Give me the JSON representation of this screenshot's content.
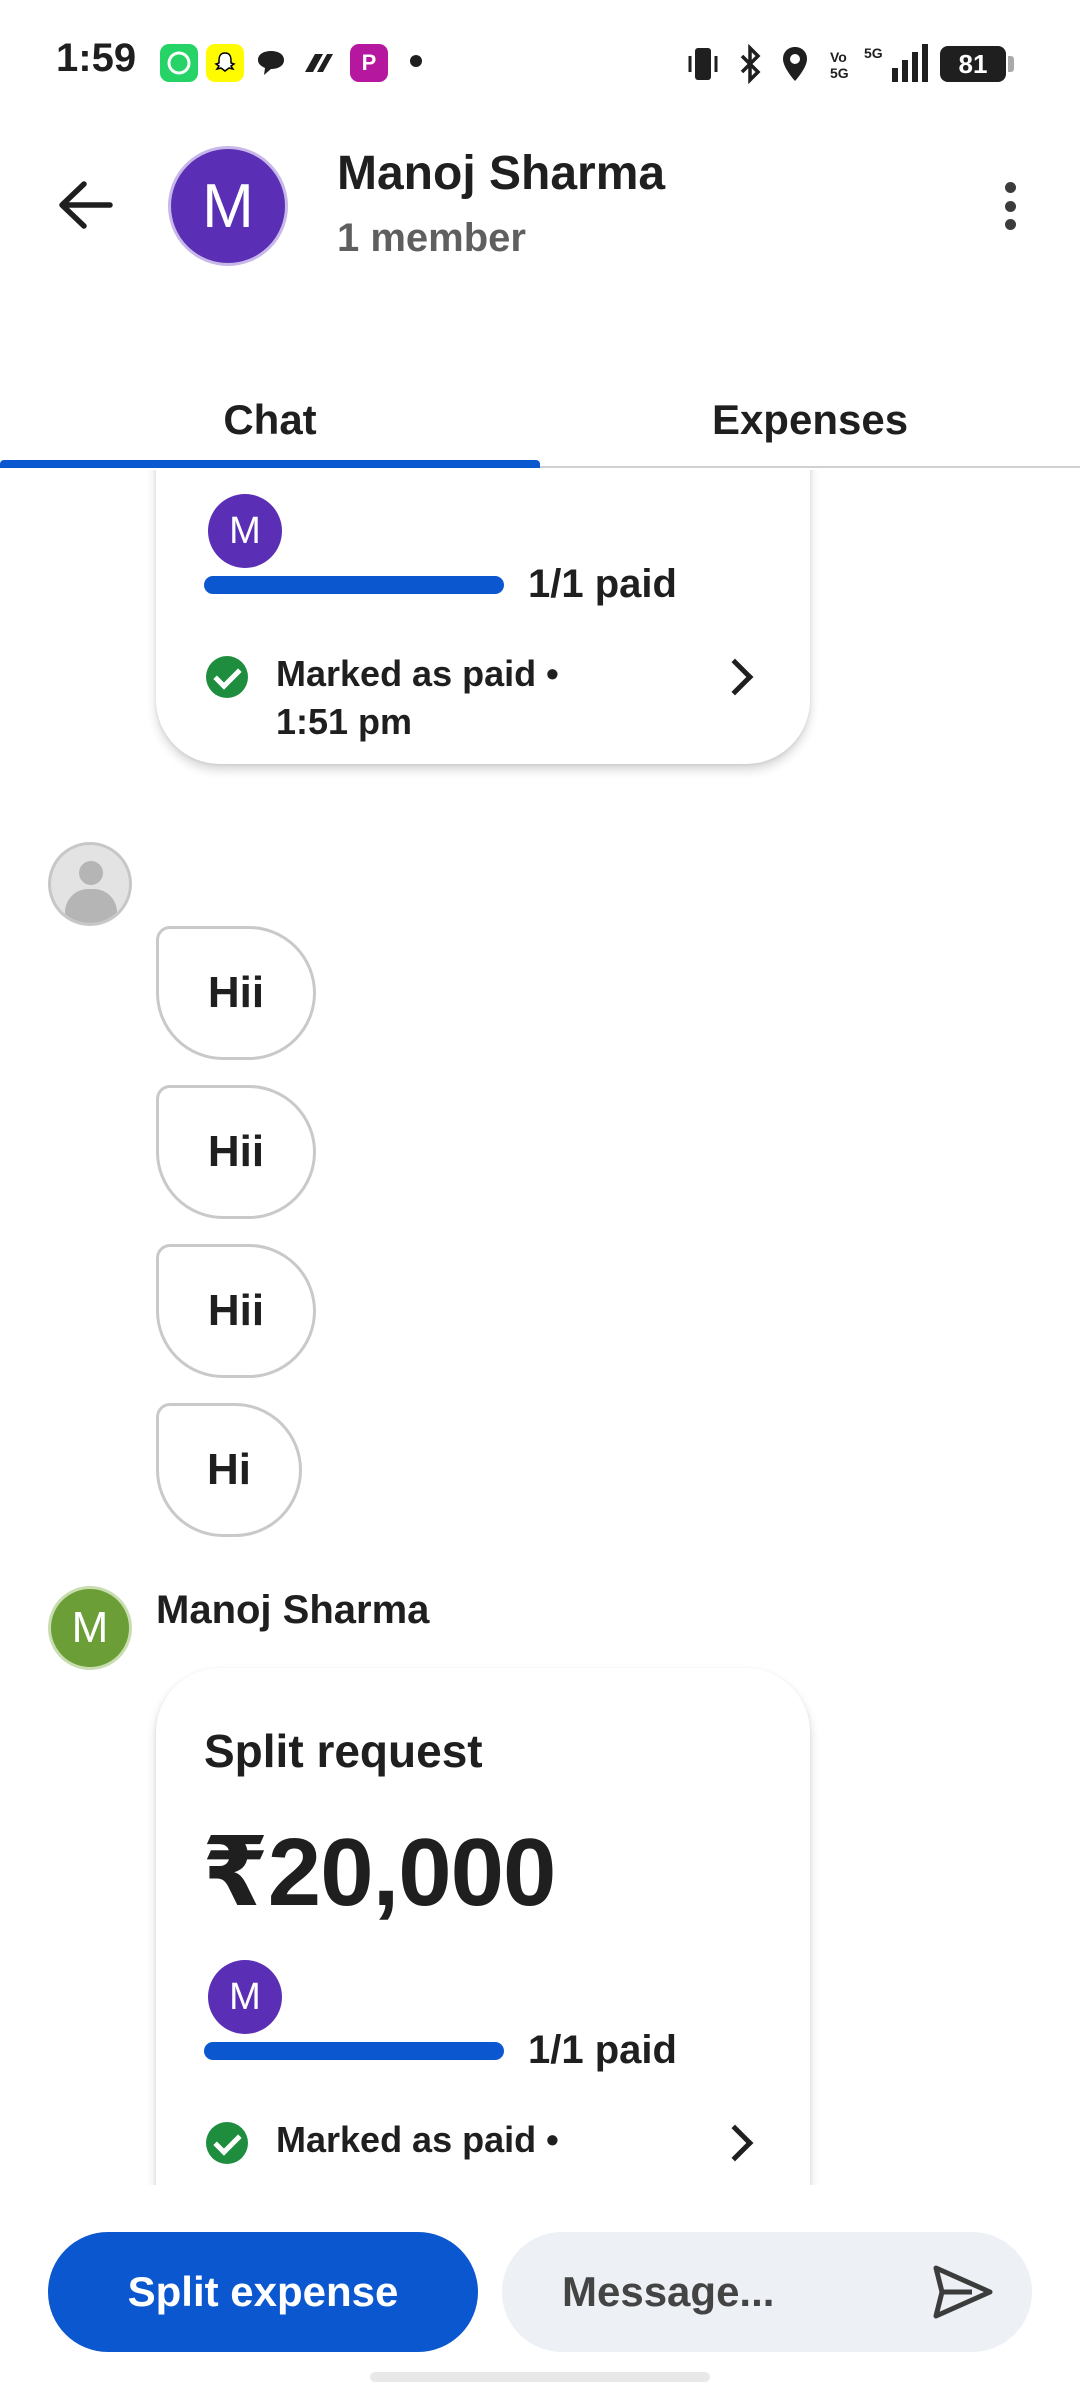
{
  "status_bar": {
    "time": "1:59",
    "notification_icons": [
      "whatsapp-icon",
      "snapchat-icon",
      "chat-bubble-icon",
      "paytm-icon",
      "phonepe-icon"
    ],
    "battery": "81",
    "network": "5G"
  },
  "header": {
    "avatar_letter": "M",
    "title": "Manoj Sharma",
    "subtitle": "1 member"
  },
  "tabs": [
    {
      "label": "Chat",
      "active": true
    },
    {
      "label": "Expenses",
      "active": false
    }
  ],
  "messages": {
    "top_card": {
      "avatar_letter": "M",
      "paid_status": "1/1 paid",
      "marked_text": "Marked as paid • 1:51 pm"
    },
    "bubbles": [
      "Hii",
      "Hii",
      "Hii",
      "Hi"
    ],
    "sender": {
      "name": "Manoj Sharma",
      "avatar_letter": "M"
    },
    "split_card": {
      "title": "Split request",
      "amount": "₹20,000",
      "avatar_letter": "M",
      "paid_status": "1/1 paid",
      "marked_text": "Marked as paid •",
      "progress_fraction": 1.0
    }
  },
  "bottom": {
    "split_button_label": "Split expense",
    "message_placeholder": "Message..."
  },
  "colors": {
    "accent": "#0b57d0",
    "avatar_purple": "#5b2fb5",
    "avatar_green": "#6b9e36",
    "paid_green": "#1e8e3e"
  }
}
